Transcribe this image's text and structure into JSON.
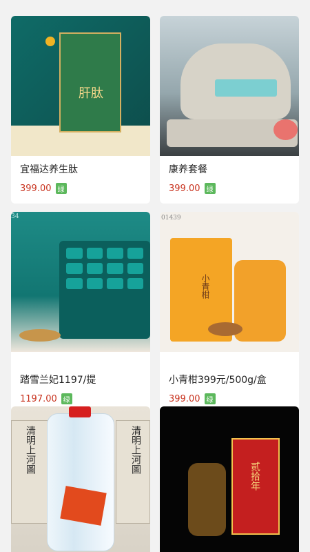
{
  "products": [
    {
      "title": "宜福达养生肽",
      "price": "399.00",
      "badge": "绿"
    },
    {
      "title": "康养套餐",
      "price": "399.00",
      "badge": "绿"
    },
    {
      "title": "踏雪兰妃1197/提",
      "price": "1197.00",
      "badge": "绿"
    },
    {
      "title": "小青柑399元/500g/盒",
      "price": "399.00",
      "badge": "绿"
    },
    {
      "title": "",
      "price": "",
      "badge": ""
    },
    {
      "title": "",
      "price": "",
      "badge": ""
    }
  ],
  "images": {
    "p1_box_text": "肝肽",
    "p3_corner": "34",
    "p4_corner": "01439",
    "p4_label": "小青柑",
    "p5_label_left": "清明上河圖",
    "p5_label_right": "清明上河圖",
    "p6_label": "贰拾年"
  },
  "colors": {
    "price": "#c8321e",
    "badge": "#5cb85c"
  }
}
